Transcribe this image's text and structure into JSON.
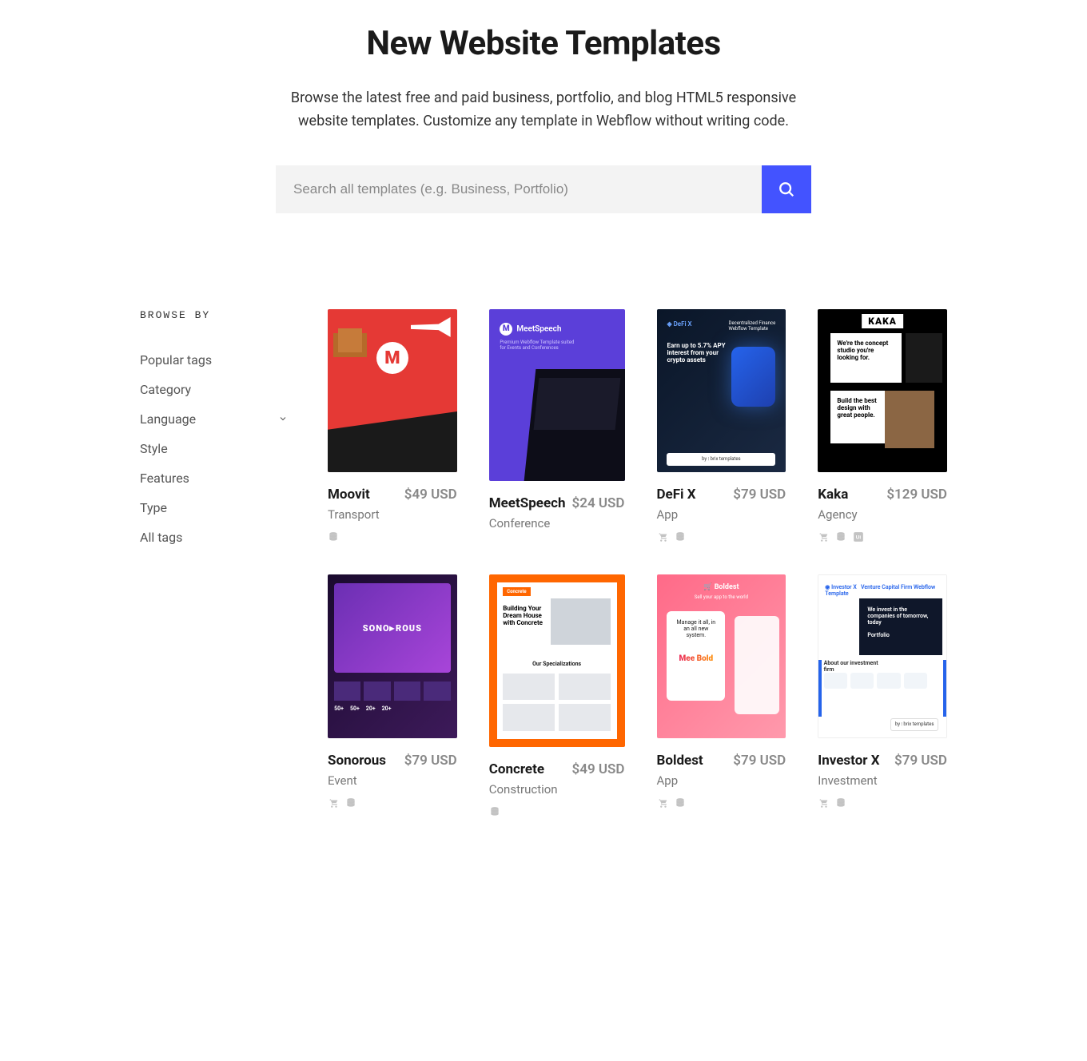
{
  "hero": {
    "title": "New Website Templates",
    "subtitle": "Browse the latest free and paid business, portfolio, and blog HTML5 responsive website templates. Customize any template in Webflow without writing code."
  },
  "search": {
    "placeholder": "Search all templates (e.g. Business, Portfolio)"
  },
  "sidebar": {
    "title": "BROWSE BY",
    "items": [
      {
        "label": "Popular tags",
        "hasChevron": false
      },
      {
        "label": "Category",
        "hasChevron": false
      },
      {
        "label": "Language",
        "hasChevron": true
      },
      {
        "label": "Style",
        "hasChevron": false
      },
      {
        "label": "Features",
        "hasChevron": false
      },
      {
        "label": "Type",
        "hasChevron": false
      },
      {
        "label": "All tags",
        "hasChevron": false
      }
    ]
  },
  "templates": [
    {
      "name": "Moovit",
      "category": "Transport",
      "price": "$49 USD",
      "icons": [
        "db"
      ],
      "mock": "moovit"
    },
    {
      "name": "MeetSpeech",
      "category": "Conference",
      "price": "$24 USD",
      "icons": [],
      "mock": "meet"
    },
    {
      "name": "DeFi X",
      "category": "App",
      "price": "$79 USD",
      "icons": [
        "cart",
        "db"
      ],
      "mock": "defi"
    },
    {
      "name": "Kaka",
      "category": "Agency",
      "price": "$129 USD",
      "icons": [
        "cart",
        "db",
        "ui"
      ],
      "mock": "kaka"
    },
    {
      "name": "Sonorous",
      "category": "Event",
      "price": "$79 USD",
      "icons": [
        "cart",
        "db"
      ],
      "mock": "son"
    },
    {
      "name": "Concrete",
      "category": "Construction",
      "price": "$49 USD",
      "icons": [
        "db"
      ],
      "mock": "conc"
    },
    {
      "name": "Boldest",
      "category": "App",
      "price": "$79 USD",
      "icons": [
        "cart",
        "db"
      ],
      "mock": "bold"
    },
    {
      "name": "Investor X",
      "category": "Investment",
      "price": "$79 USD",
      "icons": [
        "cart",
        "db"
      ],
      "mock": "inv"
    }
  ]
}
